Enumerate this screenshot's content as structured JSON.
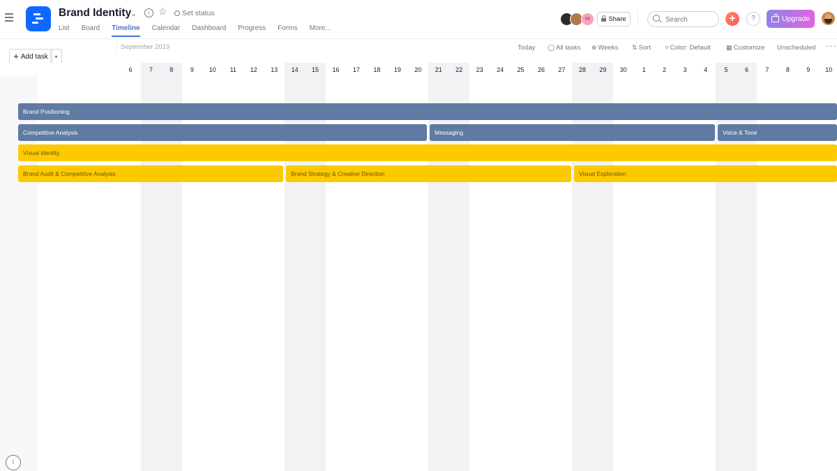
{
  "header": {
    "project_title": "Brand Identity",
    "set_status": "Set status",
    "tabs": [
      {
        "label": "List",
        "active": false
      },
      {
        "label": "Board",
        "active": false
      },
      {
        "label": "Timeline",
        "active": true
      },
      {
        "label": "Calendar",
        "active": false
      },
      {
        "label": "Dashboard",
        "active": false
      },
      {
        "label": "Progress",
        "active": false
      },
      {
        "label": "Forms",
        "active": false
      },
      {
        "label": "More...",
        "active": false
      }
    ],
    "member_avatar_initials": "NI",
    "share_label": "Share",
    "search_placeholder": "Search",
    "help_label": "?",
    "upgrade_label": "Upgrade",
    "colors": {
      "accent": "#4573d2",
      "brand_icon": "#0f68ff",
      "upgrade_gradient_start": "#8d84e8",
      "upgrade_gradient_end": "#e362e3"
    }
  },
  "toolbar": {
    "add_task_label": "Add task",
    "month_label": "September 2019",
    "today_label": "Today",
    "all_tasks_label": "All tasks",
    "weeks_label": "Weeks",
    "sort_label": "Sort",
    "color_label": "Color: Default",
    "customize_label": "Customize",
    "unscheduled_label": "Unscheduled",
    "more_label": "···"
  },
  "timeline": {
    "days": [
      "6",
      "7",
      "8",
      "9",
      "10",
      "11",
      "12",
      "13",
      "14",
      "15",
      "16",
      "17",
      "18",
      "19",
      "20",
      "21",
      "22",
      "23",
      "24",
      "25",
      "26",
      "27",
      "28",
      "29",
      "30",
      "1",
      "2",
      "3",
      "4",
      "5",
      "6",
      "7",
      "8",
      "9",
      "10"
    ],
    "weekend_pairs": [
      [
        "7",
        "8"
      ],
      [
        "14",
        "15"
      ],
      [
        "21",
        "22"
      ],
      [
        "28",
        "29"
      ],
      [
        "5",
        "6"
      ]
    ],
    "tasks": [
      {
        "name": "Brand Positioning",
        "color": "blue"
      },
      {
        "name": "Competitive Analysis",
        "color": "blue"
      },
      {
        "name": "Messaging",
        "color": "blue"
      },
      {
        "name": "Voice & Tone",
        "color": "blue"
      },
      {
        "name": "Visual identity",
        "color": "yellow"
      },
      {
        "name": "Brand Audit & Competitive Analysis",
        "color": "yellow"
      },
      {
        "name": "Brand Strategy & Creative Direction",
        "color": "yellow"
      },
      {
        "name": "Visual Exploration",
        "color": "yellow"
      }
    ],
    "colors": {
      "blue_bar": "#5f7aa3",
      "yellow_bar": "#fdca00"
    }
  }
}
